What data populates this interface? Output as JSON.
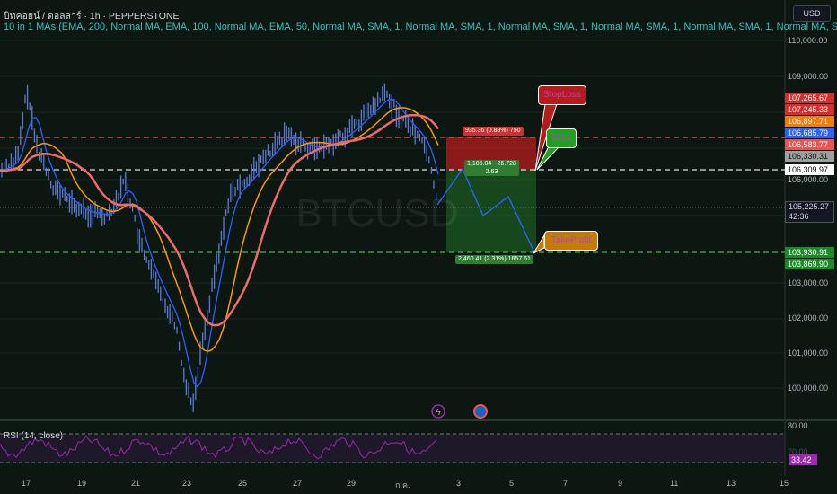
{
  "header": {
    "title": "บิทคอยน์ / ดอลลาร์ · 1h · PEPPERSTONE",
    "indicators": "10 in 1 MAs (EMA, 200, Normal MA, EMA, 100, Normal MA, EMA, 50, Normal MA, SMA, 1, Normal MA, SMA, 1, Normal MA, SMA, 1, Normal MA, SMA, 1, Normal MA, SMA, 1, Normal MA, SMA, 1, N"
  },
  "watermark": "BTCUSD",
  "currency_button": "USD",
  "price_axis": [
    "110,000.00",
    "109,000.00",
    "106,000.00",
    "103,000.00",
    "102,000.00",
    "101,000.00",
    "100,000.00"
  ],
  "price_tags": {
    "p1": "107,265.67",
    "p2": "107,245.33",
    "p3": "106,897.71",
    "p4": "106,685.79",
    "p5": "106,583.77",
    "p6": "106,330.31",
    "p7": "106,309.97",
    "p8": "105,225.27",
    "countdown": "42:36",
    "p9": "103,930.91",
    "p10": "103,869.90"
  },
  "position": {
    "stop_label": "935.36 (0.88%) 750",
    "entry_label_1": "1,105.04 - 26.728",
    "entry_label_2": "2.63",
    "target_label": "2,460.41 (2.31%) 1657.61"
  },
  "callouts": {
    "stoploss": "StopLoss",
    "sell": "SELL",
    "takeprofit": "TakeProfit"
  },
  "rsi": {
    "title": "RSI (14, close)",
    "level_upper": "80.00",
    "level_mid": "70.00",
    "value": "33.42"
  },
  "dates": [
    "17",
    "19",
    "21",
    "23",
    "25",
    "27",
    "29",
    "ก.ค.",
    "3",
    "5",
    "7",
    "9",
    "11",
    "13",
    "15"
  ],
  "colors": {
    "background": "#0c1711",
    "candle": "#5b7bd5",
    "ema_fast": "#2962ff",
    "ema_mid": "#ff9800",
    "ema_slow": "#ef5350",
    "stop_zone": "#b71c1c",
    "target_zone": "#1b5e20",
    "rsi": "#9c27b0"
  }
}
